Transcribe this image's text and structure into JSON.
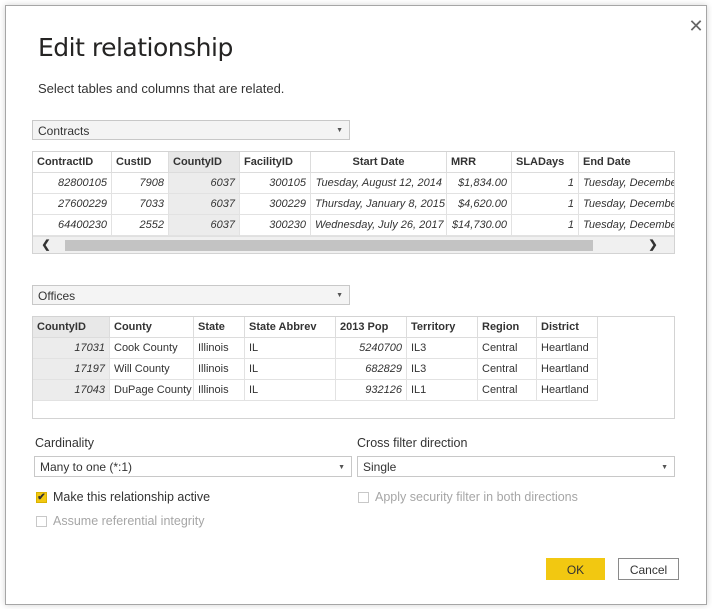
{
  "dialog": {
    "title": "Edit relationship",
    "subtitle": "Select tables and columns that are related.",
    "close_icon": "close-icon",
    "close_glyph": "✕"
  },
  "table1": {
    "selected": "Contracts",
    "columns": [
      "ContractID",
      "CustID",
      "CountyID",
      "FacilityID",
      "Start Date",
      "MRR",
      "SLADays",
      "End Date"
    ],
    "rows": [
      [
        "82800105",
        "7908",
        "6037",
        "300105",
        "Tuesday, August 12, 2014",
        "$1,834.00",
        "1",
        "Tuesday, Decembe"
      ],
      [
        "27600229",
        "7033",
        "6037",
        "300229",
        "Thursday, January 8, 2015",
        "$4,620.00",
        "1",
        "Tuesday, Decembe"
      ],
      [
        "64400230",
        "2552",
        "6037",
        "300230",
        "Wednesday, July 26, 2017",
        "$14,730.00",
        "1",
        "Tuesday, Decembe"
      ]
    ],
    "highlighted_column": "CountyID",
    "scroll_left_glyph": "❮",
    "scroll_right_glyph": "❯"
  },
  "table2": {
    "selected": "Offices",
    "columns": [
      "CountyID",
      "County",
      "State",
      "State Abbrev",
      "2013 Pop",
      "Territory",
      "Region",
      "District"
    ],
    "rows": [
      [
        "17031",
        "Cook County",
        "Illinois",
        "IL",
        "5240700",
        "IL3",
        "Central",
        "Heartland"
      ],
      [
        "17197",
        "Will County",
        "Illinois",
        "IL",
        "682829",
        "IL3",
        "Central",
        "Heartland"
      ],
      [
        "17043",
        "DuPage County",
        "Illinois",
        "IL",
        "932126",
        "IL1",
        "Central",
        "Heartland"
      ]
    ],
    "highlighted_column": "CountyID"
  },
  "cardinality": {
    "label": "Cardinality",
    "selected": "Many to one (*:1)"
  },
  "cross_filter": {
    "label": "Cross filter direction",
    "selected": "Single"
  },
  "options": {
    "make_active": {
      "label": "Make this relationship active",
      "checked": true,
      "enabled": true
    },
    "referential_integrity": {
      "label": "Assume referential integrity",
      "checked": false,
      "enabled": false
    },
    "security_filter": {
      "label": "Apply security filter in both directions",
      "checked": false,
      "enabled": false
    }
  },
  "buttons": {
    "ok": "OK",
    "cancel": "Cancel"
  },
  "colors": {
    "accent": "#F2C811",
    "highlight_col": "#ECECEC"
  },
  "dropdown_arrow": "▼"
}
